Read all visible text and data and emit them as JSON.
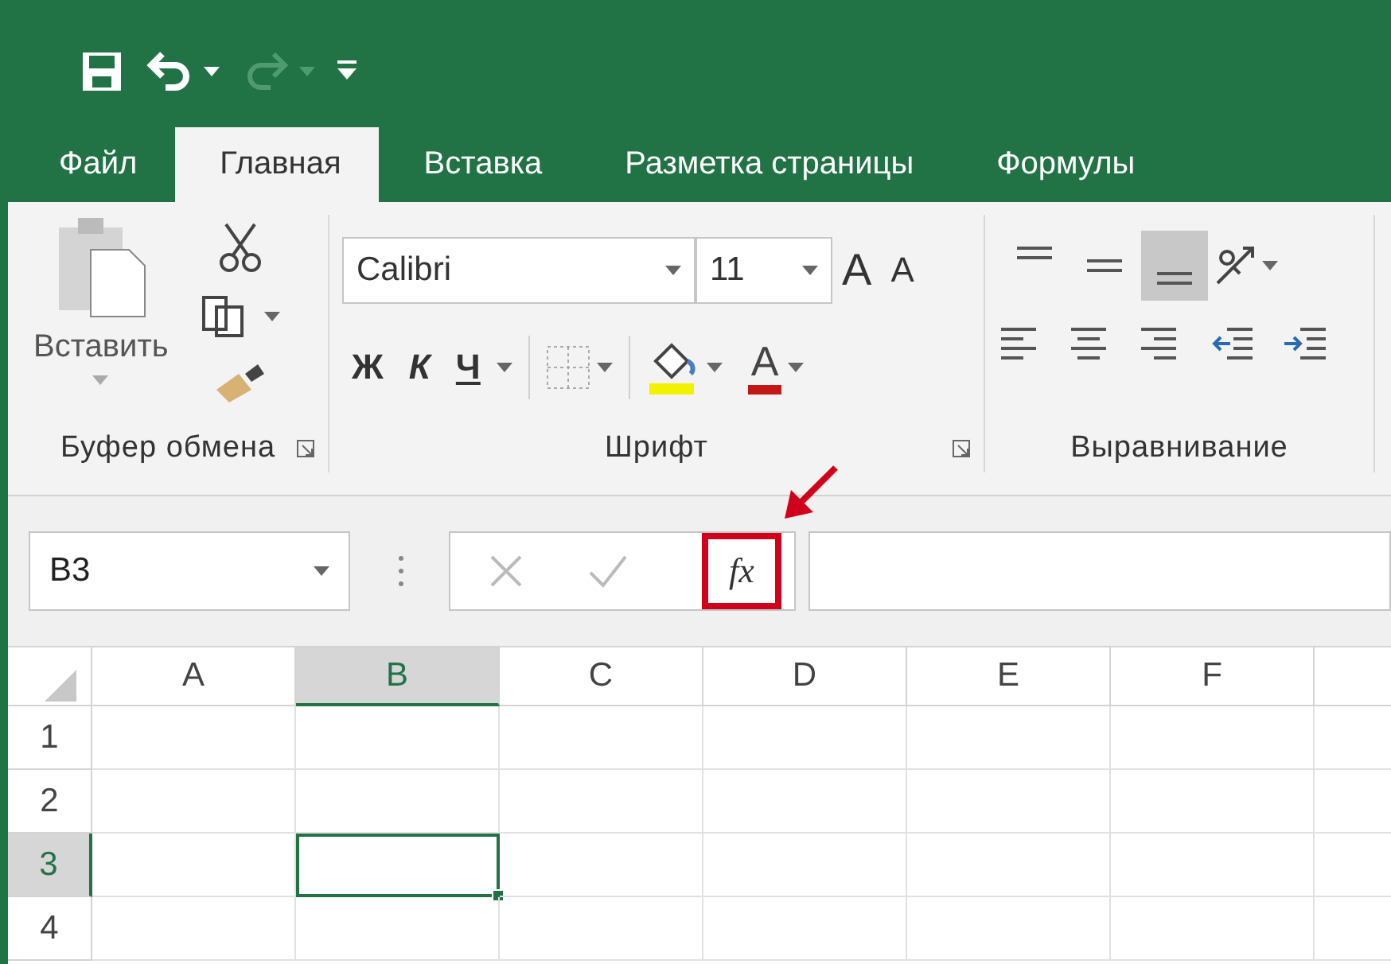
{
  "tabs": [
    {
      "label": "Файл",
      "selected": false
    },
    {
      "label": "Главная",
      "selected": true
    },
    {
      "label": "Вставка",
      "selected": false
    },
    {
      "label": "Разметка страницы",
      "selected": false
    },
    {
      "label": "Формулы",
      "selected": false
    }
  ],
  "clipboard": {
    "paste_label": "Вставить",
    "group_label": "Буфер обмена"
  },
  "font": {
    "name": "Calibri",
    "size": "11",
    "grow": "A",
    "shrink": "A",
    "bold": "Ж",
    "italic": "К",
    "underline": "Ч",
    "font_color": "A",
    "group_label": "Шрифт"
  },
  "alignment": {
    "group_label": "Выравнивание",
    "vertical": [
      {
        "selected": false
      },
      {
        "selected": false
      },
      {
        "selected": true
      }
    ]
  },
  "formula_bar": {
    "name_box": "B3",
    "fx": {
      "label": "fx",
      "highlighted": true
    }
  },
  "sheet": {
    "columns": [
      {
        "label": "A",
        "selected": false
      },
      {
        "label": "B",
        "selected": true
      },
      {
        "label": "C",
        "selected": false
      },
      {
        "label": "D",
        "selected": false
      },
      {
        "label": "E",
        "selected": false
      },
      {
        "label": "F",
        "selected": false
      }
    ],
    "rows": [
      {
        "label": "1",
        "selected": false
      },
      {
        "label": "2",
        "selected": false
      },
      {
        "label": "3",
        "selected": true
      },
      {
        "label": "4",
        "selected": false
      }
    ]
  }
}
